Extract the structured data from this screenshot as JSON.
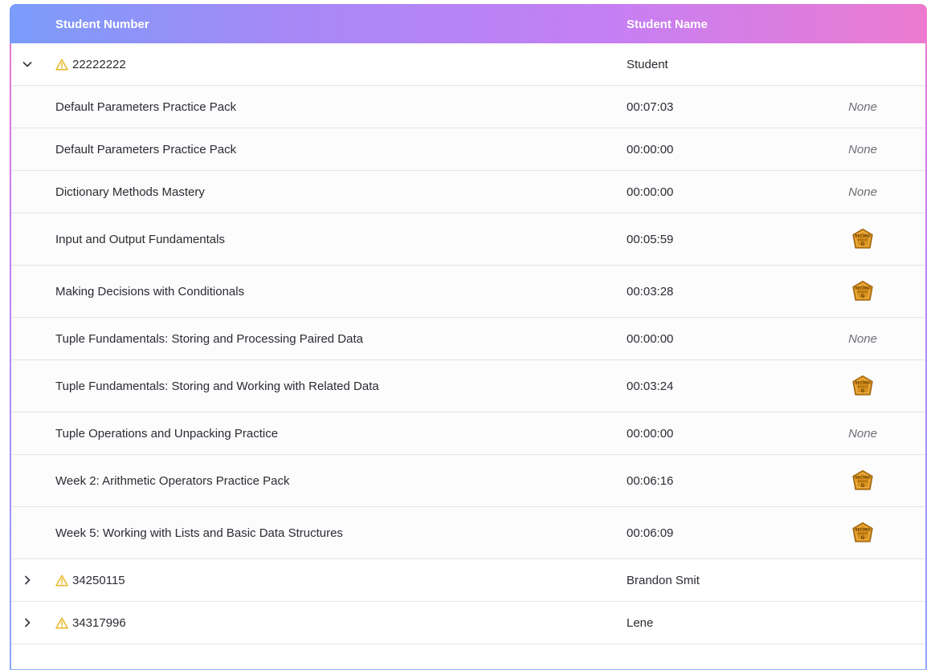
{
  "table": {
    "columns": {
      "student_number": "Student Number",
      "student_name": "Student Name"
    },
    "groups": [
      {
        "number": "22222222",
        "name": "Student",
        "expanded": true,
        "warning": true,
        "tasks": [
          {
            "title": "Default Parameters Practice Pack",
            "time": "00:07:03",
            "result": "None",
            "badge": false
          },
          {
            "title": "Default Parameters Practice Pack",
            "time": "00:00:00",
            "result": "None",
            "badge": false
          },
          {
            "title": "Dictionary Methods Mastery",
            "time": "00:00:00",
            "result": "None",
            "badge": false
          },
          {
            "title": "Input and Output Fundamentals",
            "time": "00:05:59",
            "result": "",
            "badge": true
          },
          {
            "title": "Making Decisions with Conditionals",
            "time": "00:03:28",
            "result": "",
            "badge": true
          },
          {
            "title": "Tuple Fundamentals: Storing and Processing Paired Data",
            "time": "00:00:00",
            "result": "None",
            "badge": false
          },
          {
            "title": "Tuple Fundamentals: Storing and Working with Related Data",
            "time": "00:03:24",
            "result": "",
            "badge": true
          },
          {
            "title": "Tuple Operations and Unpacking Practice",
            "time": "00:00:00",
            "result": "None",
            "badge": false
          },
          {
            "title": "Week 2: Arithmetic Operators Practice Pack",
            "time": "00:06:16",
            "result": "",
            "badge": true
          },
          {
            "title": "Week 5: Working with Lists and Basic Data Structures",
            "time": "00:06:09",
            "result": "",
            "badge": true
          }
        ]
      },
      {
        "number": "34250115",
        "name": "Brandon Smit",
        "expanded": false,
        "warning": true,
        "tasks": []
      },
      {
        "number": "34317996",
        "name": "Lene",
        "expanded": false,
        "warning": true,
        "tasks": []
      }
    ],
    "badge_text": {
      "top": "RECORD",
      "middle": "BADGE",
      "letter": "G"
    }
  },
  "colors": {
    "warning": "#e9b723",
    "badge_fill": "#d9921c",
    "badge_stroke": "#9a5e0b",
    "header_gradient_start": "#7b9cfb",
    "header_gradient_end": "#ec7bd0"
  }
}
